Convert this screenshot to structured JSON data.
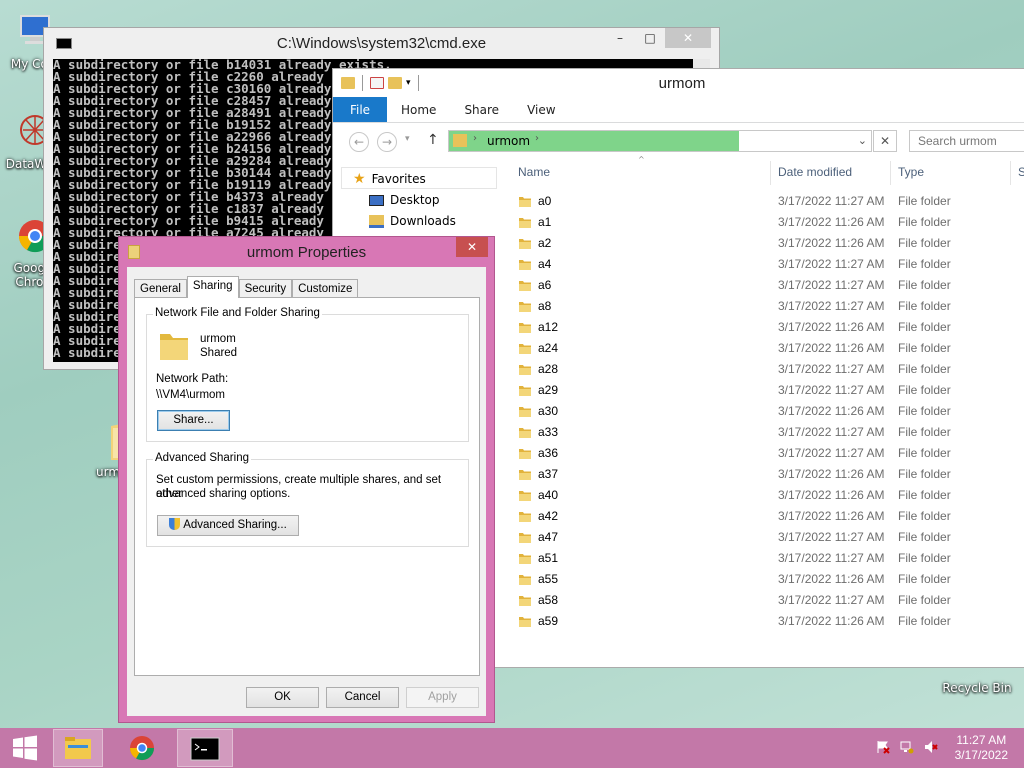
{
  "desktop": {
    "icons": [
      {
        "label": "My Co..."
      },
      {
        "label": "DataWa..."
      },
      {
        "label": "Goog... Chro..."
      },
      {
        "label": "urm..."
      },
      {
        "label": "Recycle Bin"
      }
    ]
  },
  "cmd": {
    "title": "C:\\Windows\\system32\\cmd.exe",
    "lines": [
      "A subdirectory or file b14031 already exists.",
      "A subdirectory or file c2260 already exists.",
      "A subdirectory or file c30160 already exists.",
      "A subdirectory or file c28457 already exists.",
      "A subdirectory or file a28491 already exists.",
      "A subdirectory or file b19152 already exists.",
      "A subdirectory or file a22966 already exists.",
      "A subdirectory or file b24156 already exists.",
      "A subdirectory or file a29284 already exists.",
      "A subdirectory or file b30144 already exists.",
      "A subdirectory or file b19119 already exists.",
      "A subdirectory or file b4373 already exists.",
      "A subdirectory or file c1837 already exists.",
      "A subdirectory or file b9415 already exists.",
      "A subdirectory or file a7245 already exists.",
      "A subdirectory or file",
      "A subdirectory or file",
      "A subdirectory or file",
      "A subdirectory or file",
      "A subdirectory or file",
      "A subdirectory or file",
      "A subdirectory or file",
      "A subdirectory or file",
      "A subdirectory or file",
      "A subdirectory or file"
    ],
    "controls": {
      "minimize": "–",
      "maximize": "□",
      "close": "✕"
    }
  },
  "explorer": {
    "title": "urmom",
    "tabs": {
      "file": "File",
      "home": "Home",
      "share": "Share",
      "view": "View"
    },
    "path": "urmom",
    "search_placeholder": "Search urmom",
    "nav": {
      "favorites": "Favorites",
      "desktop": "Desktop",
      "downloads": "Downloads"
    },
    "columns": {
      "name": "Name",
      "date": "Date modified",
      "type": "Type",
      "size": "S"
    },
    "files": [
      {
        "name": "a0",
        "date": "3/17/2022 11:27 AM",
        "type": "File folder"
      },
      {
        "name": "a1",
        "date": "3/17/2022 11:26 AM",
        "type": "File folder"
      },
      {
        "name": "a2",
        "date": "3/17/2022 11:26 AM",
        "type": "File folder"
      },
      {
        "name": "a4",
        "date": "3/17/2022 11:27 AM",
        "type": "File folder"
      },
      {
        "name": "a6",
        "date": "3/17/2022 11:27 AM",
        "type": "File folder"
      },
      {
        "name": "a8",
        "date": "3/17/2022 11:27 AM",
        "type": "File folder"
      },
      {
        "name": "a12",
        "date": "3/17/2022 11:26 AM",
        "type": "File folder"
      },
      {
        "name": "a24",
        "date": "3/17/2022 11:26 AM",
        "type": "File folder"
      },
      {
        "name": "a28",
        "date": "3/17/2022 11:27 AM",
        "type": "File folder"
      },
      {
        "name": "a29",
        "date": "3/17/2022 11:27 AM",
        "type": "File folder"
      },
      {
        "name": "a30",
        "date": "3/17/2022 11:26 AM",
        "type": "File folder"
      },
      {
        "name": "a33",
        "date": "3/17/2022 11:27 AM",
        "type": "File folder"
      },
      {
        "name": "a36",
        "date": "3/17/2022 11:27 AM",
        "type": "File folder"
      },
      {
        "name": "a37",
        "date": "3/17/2022 11:26 AM",
        "type": "File folder"
      },
      {
        "name": "a40",
        "date": "3/17/2022 11:26 AM",
        "type": "File folder"
      },
      {
        "name": "a42",
        "date": "3/17/2022 11:26 AM",
        "type": "File folder"
      },
      {
        "name": "a47",
        "date": "3/17/2022 11:27 AM",
        "type": "File folder"
      },
      {
        "name": "a51",
        "date": "3/17/2022 11:27 AM",
        "type": "File folder"
      },
      {
        "name": "a55",
        "date": "3/17/2022 11:26 AM",
        "type": "File folder"
      },
      {
        "name": "a58",
        "date": "3/17/2022 11:27 AM",
        "type": "File folder"
      },
      {
        "name": "a59",
        "date": "3/17/2022 11:26 AM",
        "type": "File folder"
      }
    ]
  },
  "properties": {
    "title": "urmom Properties",
    "tabs": {
      "general": "General",
      "sharing": "Sharing",
      "security": "Security",
      "customize": "Customize"
    },
    "network_group_title": "Network File and Folder Sharing",
    "folder_name": "urmom",
    "folder_status": "Shared",
    "network_path_label": "Network Path:",
    "network_path": "\\\\VM4\\urmom",
    "share_button": "Share...",
    "advanced_group_title": "Advanced Sharing",
    "advanced_desc_1": "Set custom permissions, create multiple shares, and set other",
    "advanced_desc_2": "advanced sharing options.",
    "advanced_button": "Advanced Sharing...",
    "ok": "OK",
    "cancel": "Cancel",
    "apply": "Apply",
    "close": "✕"
  },
  "taskbar": {
    "time": "11:27 AM",
    "date": "3/17/2022"
  },
  "colors": {
    "accent_file_tab": "#1979ca",
    "dialog_frame": "#d877b5",
    "taskbar": "#c378a8",
    "address_progress": "#7fd48a"
  }
}
